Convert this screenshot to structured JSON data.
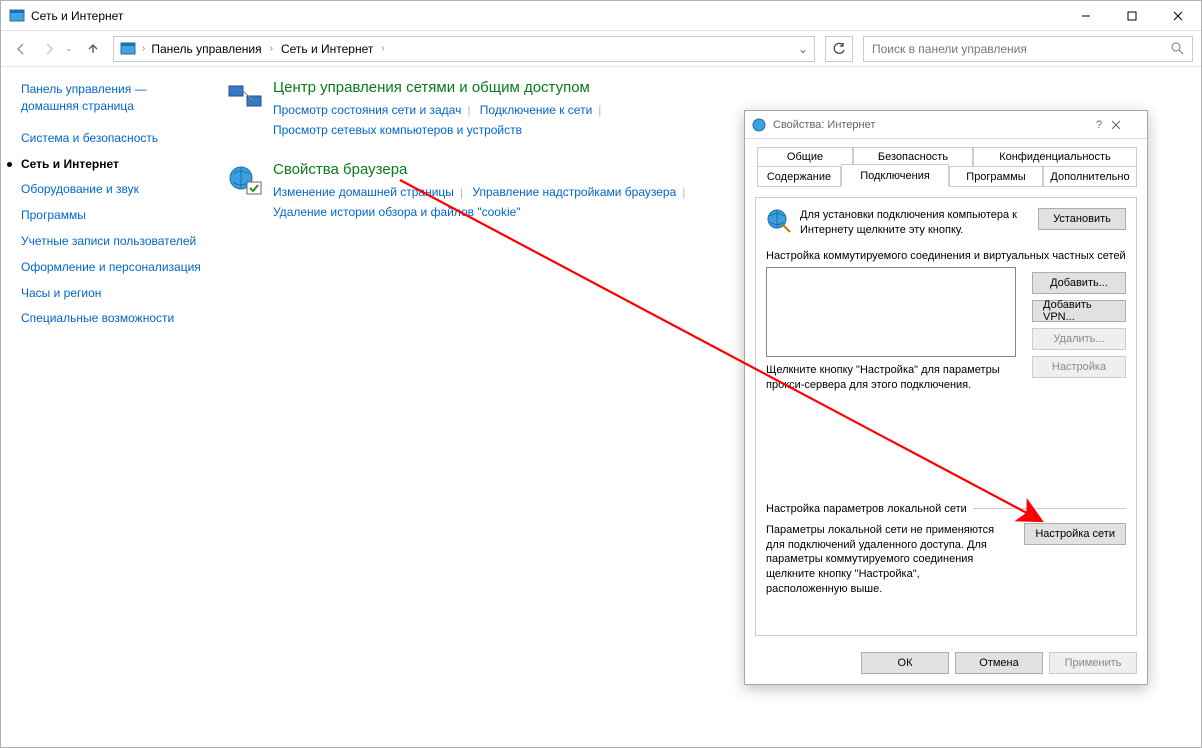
{
  "window": {
    "title": "Сеть и Интернет"
  },
  "breadcrumb": {
    "root": "Панель управления",
    "current": "Сеть и Интернет"
  },
  "search": {
    "placeholder": "Поиск в панели управления"
  },
  "sidebar": {
    "home": "Панель управления — домашняя страница",
    "items": [
      "Система и безопасность",
      "Сеть и Интернет",
      "Оборудование и звук",
      "Программы",
      "Учетные записи пользователей",
      "Оформление и персонализация",
      "Часы и регион",
      "Специальные возможности"
    ],
    "current_index": 1
  },
  "sections": [
    {
      "title": "Центр управления сетями и общим доступом",
      "links": [
        "Просмотр состояния сети и задач",
        "Подключение к сети",
        "Просмотр сетевых компьютеров и устройств"
      ]
    },
    {
      "title": "Свойства браузера",
      "links": [
        "Изменение домашней страницы",
        "Управление надстройками браузера",
        "Удаление истории обзора и файлов \"cookie\""
      ]
    }
  ],
  "dialog": {
    "title": "Свойства: Интернет",
    "tabs": {
      "general": "Общие",
      "security": "Безопасность",
      "privacy": "Конфиденциальность",
      "content": "Содержание",
      "connections": "Подключения",
      "programs": "Программы",
      "advanced": "Дополнительно"
    },
    "setup_text": "Для установки подключения компьютера к Интернету щелкните эту кнопку.",
    "setup_button": "Установить",
    "dialup_label": "Настройка коммутируемого соединения и виртуальных частных сетей",
    "add_button": "Добавить...",
    "add_vpn_button": "Добавить VPN...",
    "remove_button": "Удалить...",
    "settings_button": "Настройка",
    "proxy_note": "Щелкните кнопку \"Настройка\" для параметры прокси-сервера для этого подключения.",
    "lan_label": "Настройка параметров локальной сети",
    "lan_text": "Параметры локальной сети не применяются для подключений удаленного доступа. Для параметры коммутируемого соединения щелкните кнопку \"Настройка\", расположенную выше.",
    "lan_button": "Настройка сети",
    "ok": "ОК",
    "cancel": "Отмена",
    "apply": "Применить"
  }
}
